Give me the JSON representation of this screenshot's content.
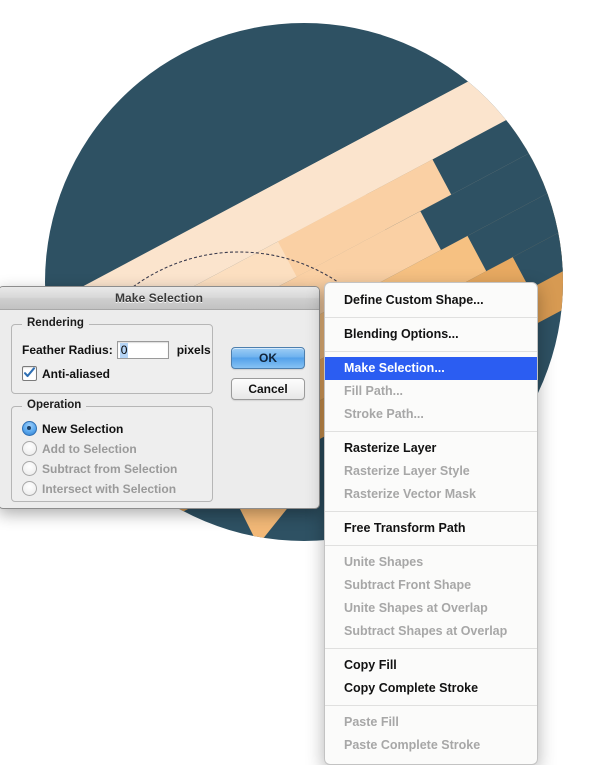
{
  "artwork": {
    "name": "abstract-illustration",
    "circle_color": "#2e5163",
    "band_colors": [
      "#fbe4cd",
      "#fcdfc0",
      "#fad0a4",
      "#f6c182",
      "#e7a961",
      "#d79a52"
    ],
    "path_outline_color": "#3b3b4d",
    "background": "#ffffff"
  },
  "dialog": {
    "title": "Make Selection",
    "rendering": {
      "legend": "Rendering",
      "feather_label": "Feather Radius:",
      "feather_value": "0",
      "feather_placeholder": "0",
      "feather_units": "pixels",
      "antialias_label": "Anti-aliased",
      "antialias_checked": true
    },
    "operation": {
      "legend": "Operation",
      "options": [
        {
          "label": "New Selection",
          "selected": true,
          "enabled": true
        },
        {
          "label": "Add to Selection",
          "selected": false,
          "enabled": false
        },
        {
          "label": "Subtract from Selection",
          "selected": false,
          "enabled": false
        },
        {
          "label": "Intersect with Selection",
          "selected": false,
          "enabled": false
        }
      ]
    },
    "buttons": {
      "ok": "OK",
      "cancel": "Cancel"
    },
    "accent_color": "#2b5df2",
    "default_button_color": "#6fb2ef"
  },
  "context_menu": {
    "groups": [
      {
        "items": [
          {
            "label": "Define Custom Shape...",
            "enabled": true,
            "highlighted": false
          }
        ]
      },
      {
        "items": [
          {
            "label": "Blending Options...",
            "enabled": true,
            "highlighted": false
          }
        ]
      },
      {
        "items": [
          {
            "label": "Make Selection...",
            "enabled": true,
            "highlighted": true
          },
          {
            "label": "Fill Path...",
            "enabled": false,
            "highlighted": false
          },
          {
            "label": "Stroke Path...",
            "enabled": false,
            "highlighted": false
          }
        ]
      },
      {
        "items": [
          {
            "label": "Rasterize Layer",
            "enabled": true,
            "highlighted": false
          },
          {
            "label": "Rasterize Layer Style",
            "enabled": false,
            "highlighted": false
          },
          {
            "label": "Rasterize Vector Mask",
            "enabled": false,
            "highlighted": false
          }
        ]
      },
      {
        "items": [
          {
            "label": "Free Transform Path",
            "enabled": true,
            "highlighted": false
          }
        ]
      },
      {
        "items": [
          {
            "label": "Unite Shapes",
            "enabled": false,
            "highlighted": false
          },
          {
            "label": "Subtract Front Shape",
            "enabled": false,
            "highlighted": false
          },
          {
            "label": "Unite Shapes at Overlap",
            "enabled": false,
            "highlighted": false
          },
          {
            "label": "Subtract Shapes at Overlap",
            "enabled": false,
            "highlighted": false
          }
        ]
      },
      {
        "items": [
          {
            "label": "Copy Fill",
            "enabled": true,
            "highlighted": false
          },
          {
            "label": "Copy Complete Stroke",
            "enabled": true,
            "highlighted": false
          }
        ]
      },
      {
        "items": [
          {
            "label": "Paste Fill",
            "enabled": false,
            "highlighted": false
          },
          {
            "label": "Paste Complete Stroke",
            "enabled": false,
            "highlighted": false
          }
        ]
      }
    ]
  }
}
